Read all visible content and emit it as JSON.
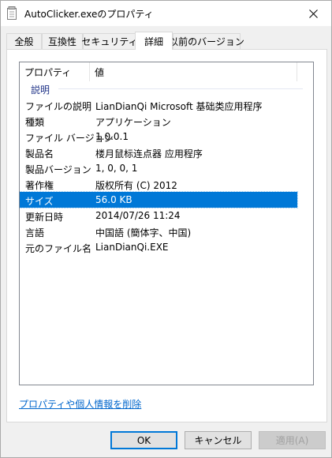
{
  "window": {
    "title": "AutoClicker.exeのプロパティ"
  },
  "tabs": [
    {
      "label": "全般"
    },
    {
      "label": "互換性"
    },
    {
      "label": "セキュリティ"
    },
    {
      "label": "詳細",
      "active": true
    },
    {
      "label": "以前のバージョン"
    }
  ],
  "list": {
    "headers": {
      "property": "プロパティ",
      "value": "値"
    },
    "group": "説明",
    "rows": [
      {
        "key": "ファイルの説明",
        "value": "LianDianQi Microsoft 基础类应用程序"
      },
      {
        "key": "種類",
        "value": "アプリケーション"
      },
      {
        "key": "ファイル バージョン",
        "value": "1.0.0.1"
      },
      {
        "key": "製品名",
        "value": "楼月鼠标连点器 应用程序"
      },
      {
        "key": "製品バージョン",
        "value": "1, 0, 0, 1"
      },
      {
        "key": "著作権",
        "value": "版权所有 (C) 2012"
      },
      {
        "key": "サイズ",
        "value": "56.0 KB",
        "selected": true
      },
      {
        "key": "更新日時",
        "value": "2014/07/26 11:24"
      },
      {
        "key": "言語",
        "value": "中国語 (簡体字、中国)"
      },
      {
        "key": "元のファイル名",
        "value": "LianDianQi.EXE"
      }
    ]
  },
  "link": "プロパティや個人情報を削除",
  "buttons": {
    "ok": "OK",
    "cancel": "キャンセル",
    "apply": "適用(A)"
  },
  "colors": {
    "selection": "#0078d7",
    "link": "#0066cc",
    "group_header": "#1e3287"
  }
}
